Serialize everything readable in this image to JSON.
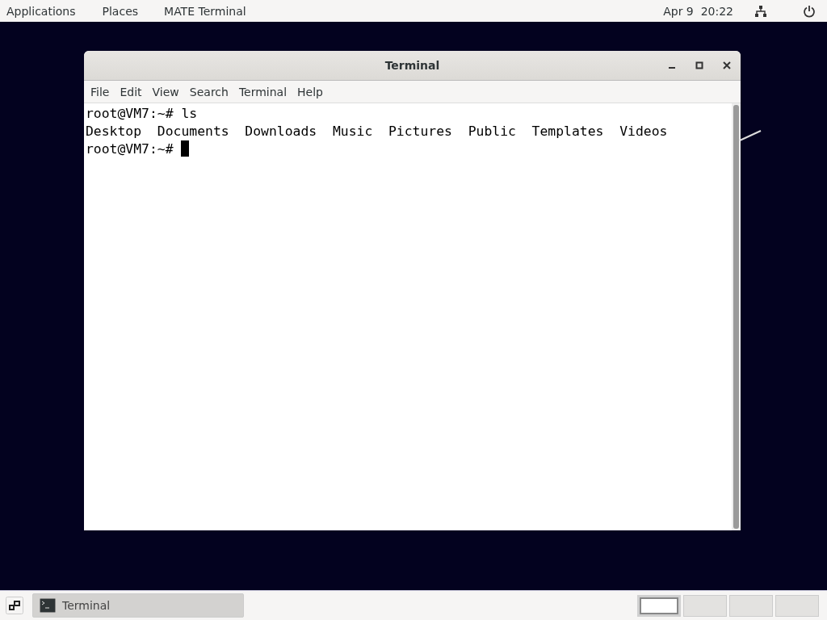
{
  "top_panel": {
    "menus": [
      "Applications",
      "Places",
      "MATE Terminal"
    ],
    "clock": "Apr 9  20:22"
  },
  "window": {
    "title": "Terminal",
    "menu": [
      "File",
      "Edit",
      "View",
      "Search",
      "Terminal",
      "Help"
    ],
    "lines": [
      "root@VM7:~# ls",
      "Desktop  Documents  Downloads  Music  Pictures  Public  Templates  Videos",
      "root@VM7:~# "
    ],
    "cursor": true
  },
  "bottom_panel": {
    "tasks": [
      {
        "label": "Terminal",
        "selected": true
      }
    ],
    "workspaces": [
      {
        "selected": true
      },
      {
        "selected": false
      },
      {
        "selected": false
      },
      {
        "selected": false
      }
    ]
  }
}
